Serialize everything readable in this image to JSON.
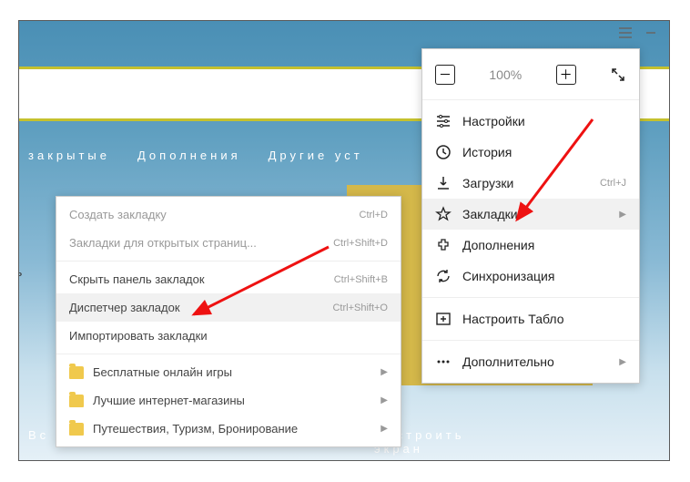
{
  "chrome": {
    "zoom": "100%",
    "minimize": "—"
  },
  "toolbar": {
    "closed": "закрытые",
    "addons": "Дополнения",
    "devices": "Другие уст"
  },
  "bottom": {
    "left": "Вс",
    "right": "Настроить экран"
  },
  "side": "сть",
  "menu": {
    "settings": "Настройки",
    "history": "История",
    "downloads": "Загрузки",
    "downloads_sc": "Ctrl+J",
    "bookmarks": "Закладки",
    "addons": "Дополнения",
    "sync": "Синхронизация",
    "tablo": "Настроить Табло",
    "more": "Дополнительно"
  },
  "sub": {
    "create": "Создать закладку",
    "create_sc": "Ctrl+D",
    "open_tabs": "Закладки для открытых страниц...",
    "open_tabs_sc": "Ctrl+Shift+D",
    "hide_bar": "Скрыть панель закладок",
    "hide_bar_sc": "Ctrl+Shift+B",
    "manager": "Диспетчер закладок",
    "manager_sc": "Ctrl+Shift+O",
    "import": "Импортировать закладки",
    "folder1": "Бесплатные онлайн игры",
    "folder2": "Лучшие интернет-магазины",
    "folder3": "Путешествия, Туризм, Бронирование"
  }
}
